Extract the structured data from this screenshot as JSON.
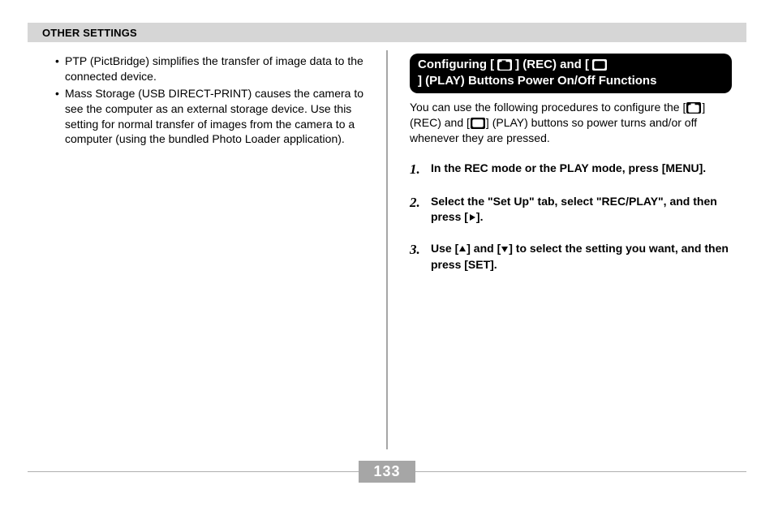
{
  "header": {
    "title": "OTHER SETTINGS"
  },
  "left": {
    "bullets": [
      "PTP (PictBridge) simplifies the transfer of image data to the connected device.",
      "Mass Storage (USB DIRECT-PRINT) causes the camera to see the computer as an external storage device. Use this setting for normal transfer of images from the camera to a computer (using the bundled Photo Loader application)."
    ]
  },
  "right": {
    "section_title_prefix": "Configuring [",
    "section_title_mid1": "] (REC) and [",
    "section_title_mid2": "] (PLAY) Buttons Power On/Off Functions",
    "intro_prefix": "You can use the following procedures to configure the [",
    "intro_mid1": "] (REC) and [",
    "intro_mid2": "] (PLAY) buttons so power turns and/or off whenever they are pressed.",
    "steps": [
      {
        "num": "1.",
        "text": "In the REC mode or the PLAY mode, press [MENU]."
      },
      {
        "num": "2.",
        "text_prefix": "Select the \"Set Up\" tab, select \"REC/PLAY\", and then press [",
        "text_suffix": "]."
      },
      {
        "num": "3.",
        "text_prefix": "Use [",
        "text_mid": "] and [",
        "text_suffix": "] to select the setting you want, and then press [SET]."
      }
    ]
  },
  "page_number": "133"
}
